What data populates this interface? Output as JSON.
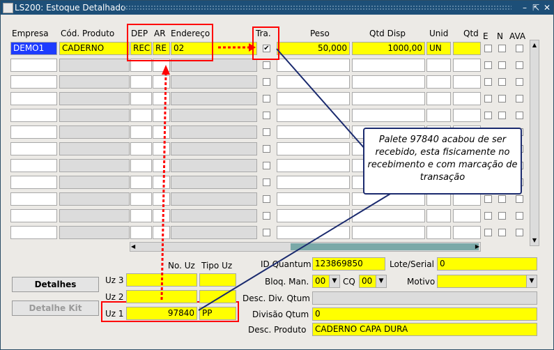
{
  "window": {
    "title": "LS200: Estoque Detalhado"
  },
  "columns": {
    "empresa": "Empresa",
    "cod_produto": "Cód. Produto",
    "dep": "DEP",
    "ar": "AR",
    "endereco": "Endereço",
    "tra": "Tra.",
    "peso": "Peso",
    "qtd_disp": "Qtd Disp",
    "unid": "Unid",
    "qtd": "Qtd",
    "e": "E",
    "n": "N",
    "ava": "AVA"
  },
  "row1": {
    "empresa": "DEMO1",
    "cod_produto": "CADERNO",
    "dep": "REC",
    "ar": "RE",
    "endereco": "02",
    "tra_checked": "✔",
    "peso": "50,000",
    "qtd_disp": "1000,00",
    "unid": "UN"
  },
  "callout": {
    "text": "Palete 97840 acabou de ser recebido, esta fisicamente no recebimento e com marcação de transação"
  },
  "uz": {
    "header_no": "No. Uz",
    "header_tipo": "Tipo Uz",
    "uz3": "Uz 3",
    "uz2": "Uz 2",
    "uz1": "Uz 1",
    "uz1_no": "97840",
    "uz1_tipo": "PP"
  },
  "buttons": {
    "detalhes": "Detalhes",
    "detalhe_kit": "Detalhe Kit"
  },
  "detail": {
    "id_quantum_label": "ID Quantum",
    "id_quantum": "123869850",
    "lote_label": "Lote/Serial",
    "lote": "0",
    "bloq_label": "Bloq. Man.",
    "bloq": "00",
    "cq_label": "CQ",
    "cq": "00",
    "motivo_label": "Motivo",
    "motivo": "",
    "desc_div_label": "Desc. Div. Qtum",
    "divisao_label": "Divisão Qtum",
    "divisao": "0",
    "desc_produto_label": "Desc. Produto",
    "desc_produto": "CADERNO CAPA DURA"
  },
  "colors": {
    "titlebar": "#1d4f78",
    "field_highlight": "#ffff00",
    "annotation": "#ff0000",
    "selected": "#1e3cff"
  }
}
